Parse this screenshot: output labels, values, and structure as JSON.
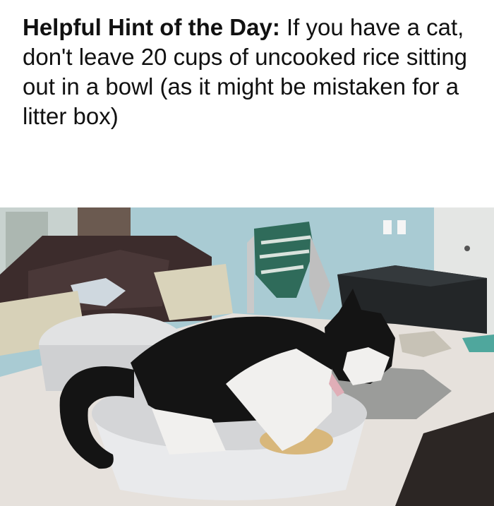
{
  "caption": {
    "lead": "Helpful Hint of the Day:",
    "body": "If you have a cat, don't leave 20 cups of uncooked rice sitting out in a bowl (as it might be mistaken for a litter box)"
  },
  "photo": {
    "subject": "cat-in-rice-pot",
    "colors": {
      "wall": "#a9cbd3",
      "counter": "#e6e1dc",
      "pot": "#e9eaec",
      "cat_black": "#141414",
      "cat_white": "#f1f0ee",
      "rice": "#d8b77b"
    }
  }
}
